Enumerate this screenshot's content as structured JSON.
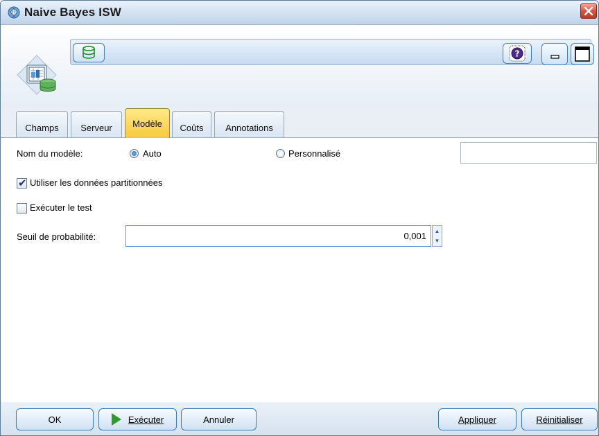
{
  "window": {
    "title": "Naive Bayes ISW"
  },
  "tabs": [
    {
      "label": "Champs",
      "active": false
    },
    {
      "label": "Serveur",
      "active": false
    },
    {
      "label": "Modèle",
      "active": true
    },
    {
      "label": "Coûts",
      "active": false
    },
    {
      "label": "Annotations",
      "active": false
    }
  ],
  "form": {
    "model_name_label": "Nom du modèle:",
    "radio_auto_label": "Auto",
    "radio_custom_label": "Personnalisé",
    "custom_name_value": "",
    "use_partitioned_label": "Utiliser les données partitionnées",
    "use_partitioned_checked": true,
    "run_test_label": "Exécuter le test",
    "run_test_checked": false,
    "threshold_label": "Seuil de probabilité:",
    "threshold_value": "0,001"
  },
  "footer": {
    "ok_label": "OK",
    "run_label": "Exécuter",
    "cancel_label": "Annuler",
    "apply_label": "Appliquer",
    "reset_label": "Réinitialiser"
  },
  "icons": {
    "title": "node-diamond-icon",
    "node": "model-nugget-icon",
    "preview": "database-icon",
    "help": "help-icon",
    "minimize": "minimize-icon",
    "maximize": "maximize-icon",
    "close": "close-icon",
    "run": "play-icon"
  },
  "colors": {
    "active_tab": "#f7c93d",
    "close_button": "#d9533f",
    "button_border": "#3d79b8"
  }
}
